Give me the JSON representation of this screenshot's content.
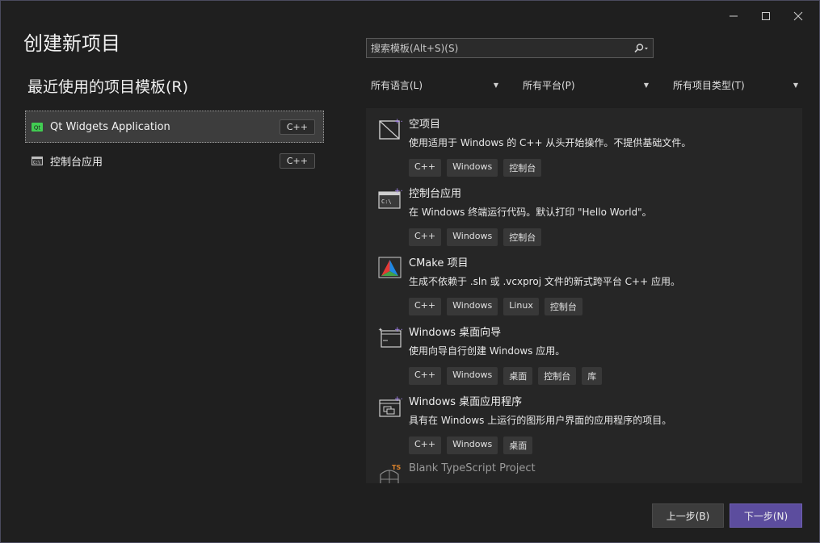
{
  "window": {
    "controls": {
      "minimize": "—",
      "maximize": "☐",
      "close": "✕"
    }
  },
  "page_title": "创建新项目",
  "recent": {
    "title": "最近使用的项目模板(R)",
    "items": [
      {
        "label": "Qt Widgets Application",
        "tag": "C++",
        "icon": "qt-logo-icon",
        "selected": true
      },
      {
        "label": "控制台应用",
        "tag": "C++",
        "icon": "console-app-icon",
        "selected": false
      }
    ]
  },
  "search": {
    "placeholder": "搜索模板(Alt+S)(S)",
    "value": ""
  },
  "filters": [
    {
      "label": "所有语言(L)"
    },
    {
      "label": "所有平台(P)"
    },
    {
      "label": "所有项目类型(T)"
    }
  ],
  "templates": [
    {
      "name": "空项目",
      "desc": "使用适用于 Windows 的 C++ 从头开始操作。不提供基础文件。",
      "tags": [
        "C++",
        "Windows",
        "控制台"
      ],
      "icon": "empty-project-icon"
    },
    {
      "name": "控制台应用",
      "desc": "在 Windows 终端运行代码。默认打印 \"Hello World\"。",
      "tags": [
        "C++",
        "Windows",
        "控制台"
      ],
      "icon": "console-app-icon"
    },
    {
      "name": "CMake 项目",
      "desc": "生成不依赖于 .sln 或 .vcxproj 文件的新式跨平台 C++ 应用。",
      "tags": [
        "C++",
        "Windows",
        "Linux",
        "控制台"
      ],
      "icon": "cmake-icon"
    },
    {
      "name": "Windows 桌面向导",
      "desc": "使用向导自行创建 Windows 应用。",
      "tags": [
        "C++",
        "Windows",
        "桌面",
        "控制台",
        "库"
      ],
      "icon": "desktop-wizard-icon"
    },
    {
      "name": "Windows 桌面应用程序",
      "desc": "具有在 Windows 上运行的图形用户界面的应用程序的项目。",
      "tags": [
        "C++",
        "Windows",
        "桌面"
      ],
      "icon": "desktop-app-icon"
    },
    {
      "name": "Blank TypeScript Project",
      "desc": "",
      "tags": [],
      "icon": "typescript-project-icon"
    }
  ],
  "buttons": {
    "back": "上一步(B)",
    "next": "下一步(N)"
  },
  "colors": {
    "accent": "#5c4d9e",
    "background": "#1f1f1f"
  }
}
